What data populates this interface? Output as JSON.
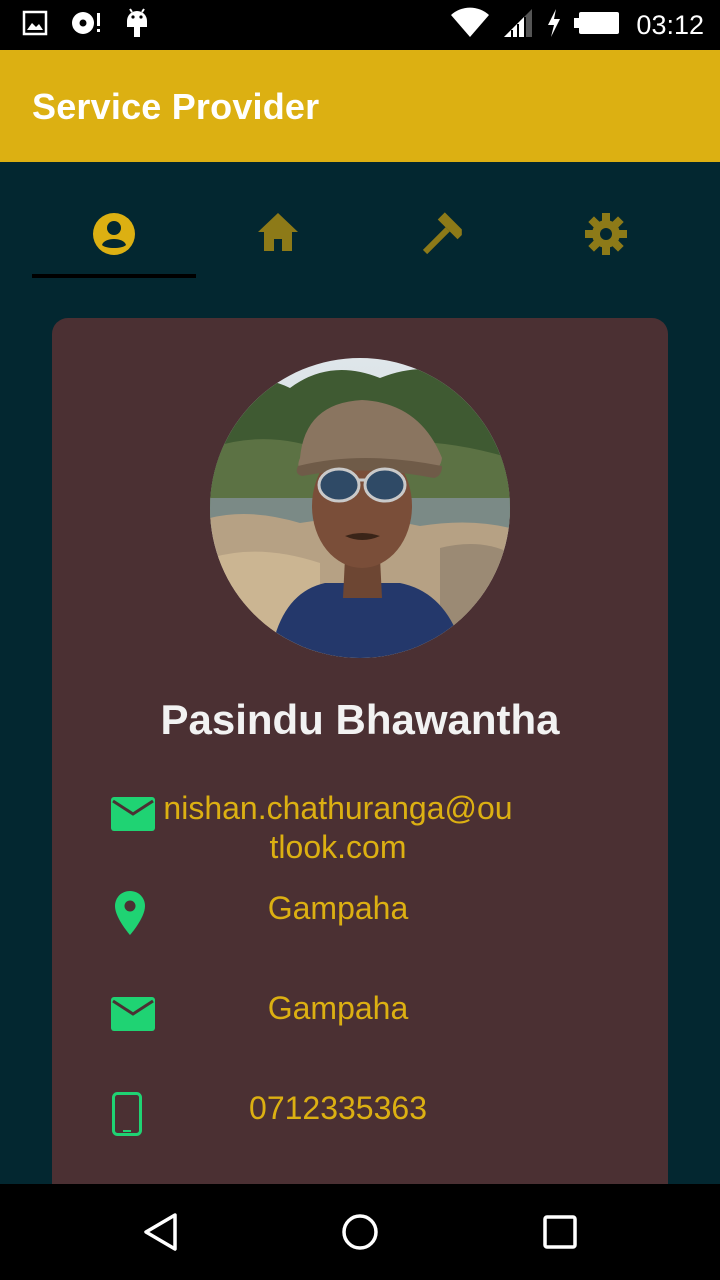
{
  "status_bar": {
    "time": "03:12",
    "icons": [
      "image-icon",
      "disc-icon",
      "android-icon",
      "wifi-icon",
      "signal-icon",
      "charging-icon",
      "battery-icon"
    ]
  },
  "app_bar": {
    "title": "Service Provider",
    "color": "#dcb012"
  },
  "tabs": [
    {
      "icon": "account-circle-icon",
      "active": true
    },
    {
      "icon": "home-icon",
      "active": false
    },
    {
      "icon": "hammer-icon",
      "active": false
    },
    {
      "icon": "gear-icon",
      "active": false
    }
  ],
  "profile": {
    "name": "Pasindu Bhawantha",
    "email": "nishan.chathuranga@outlook.com",
    "location": "Gampaha",
    "address": "Gampaha",
    "phone": "0712335363"
  },
  "colors": {
    "background": "#032730",
    "card": "#4b3033",
    "accent": "#dcb012",
    "icon_green": "#1fd373"
  },
  "nav_bar": {
    "icons": [
      "back-icon",
      "home-circle-icon",
      "recents-icon"
    ]
  }
}
